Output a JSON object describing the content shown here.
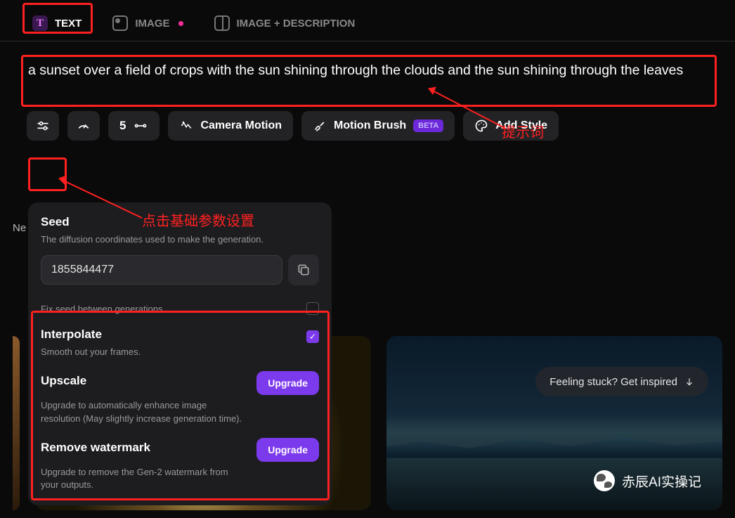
{
  "tabs": {
    "text": {
      "label": "TEXT",
      "iconChar": "T"
    },
    "image": {
      "label": "IMAGE"
    },
    "combo": {
      "label": "IMAGE + DESCRIPTION"
    }
  },
  "prompt": {
    "value": "a sunset over a field of crops with the sun shining through the clouds and the sun shining through the leaves"
  },
  "annotations": {
    "promptLabel": "提示词",
    "settingsLabel": "点击基础参数设置"
  },
  "controls": {
    "countValue": "5",
    "cameraMotion": "Camera Motion",
    "motionBrush": "Motion Brush",
    "betaBadge": "BETA",
    "addStyle": "Add Style"
  },
  "sideLabel": "Ne",
  "settings": {
    "seed": {
      "title": "Seed",
      "desc": "The diffusion coordinates used to make the generation.",
      "value": "1855844477",
      "fixLabel": "Fix seed between generations"
    },
    "interpolate": {
      "title": "Interpolate",
      "desc": "Smooth out your frames."
    },
    "upscale": {
      "title": "Upscale",
      "desc": "Upgrade to automatically enhance image resolution (May slightly increase generation time).",
      "cta": "Upgrade"
    },
    "watermark": {
      "title": "Remove watermark",
      "desc": "Upgrade to remove the Gen-2 watermark from your outputs.",
      "cta": "Upgrade"
    }
  },
  "inspire": {
    "label": "Feeling stuck? Get inspired"
  },
  "watermarkBadge": {
    "text": "赤辰AI实操记"
  }
}
